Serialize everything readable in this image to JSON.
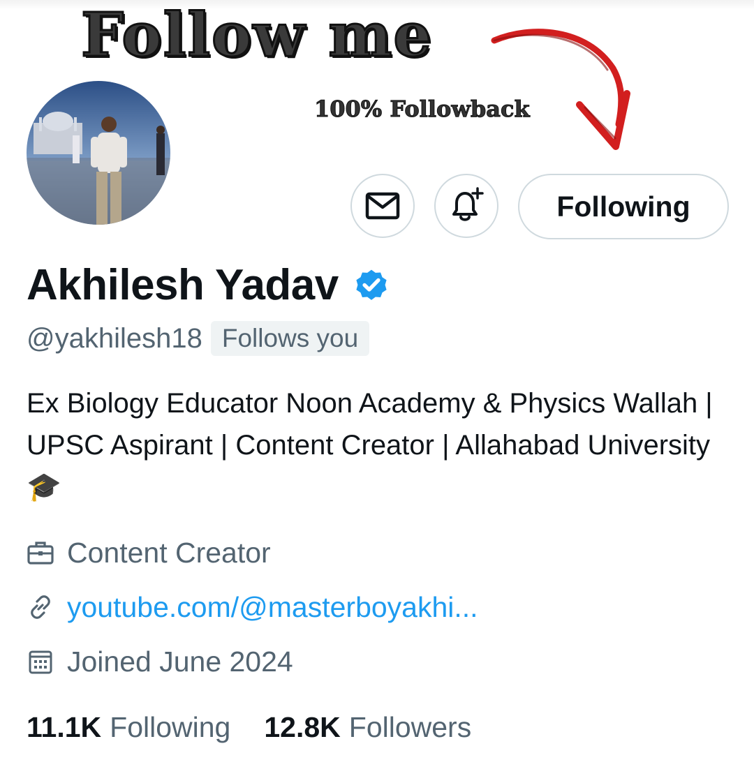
{
  "banner": {
    "title": "Follow me",
    "subtitle": "100% Followback"
  },
  "profile": {
    "name": "Akhilesh Yadav",
    "handle": "@yakhilesh18",
    "follows_you_badge": "Follows you",
    "bio": "Ex Biology Educator Noon Academy & Physics Wallah | UPSC Aspirant | Content Creator | Allahabad University 🎓",
    "category": "Content Creator",
    "website": "youtube.com/@masterboyakhi...",
    "joined": "Joined June 2024"
  },
  "actions": {
    "message_icon": "envelope-icon",
    "notify_icon": "bell-plus-icon",
    "follow_label": "Following"
  },
  "stats": {
    "following_count": "11.1K",
    "following_label": "Following",
    "followers_count": "12.8K",
    "followers_label": "Followers"
  },
  "icons": {
    "category": "briefcase-icon",
    "website": "link-icon",
    "joined": "calendar-icon",
    "verified": "verified-badge-icon"
  },
  "colors": {
    "accent_blue": "#1d9bf0",
    "text_primary": "#0f1419",
    "text_secondary": "#536471",
    "border": "#cfd9de",
    "arrow_red": "#d21f1f"
  }
}
